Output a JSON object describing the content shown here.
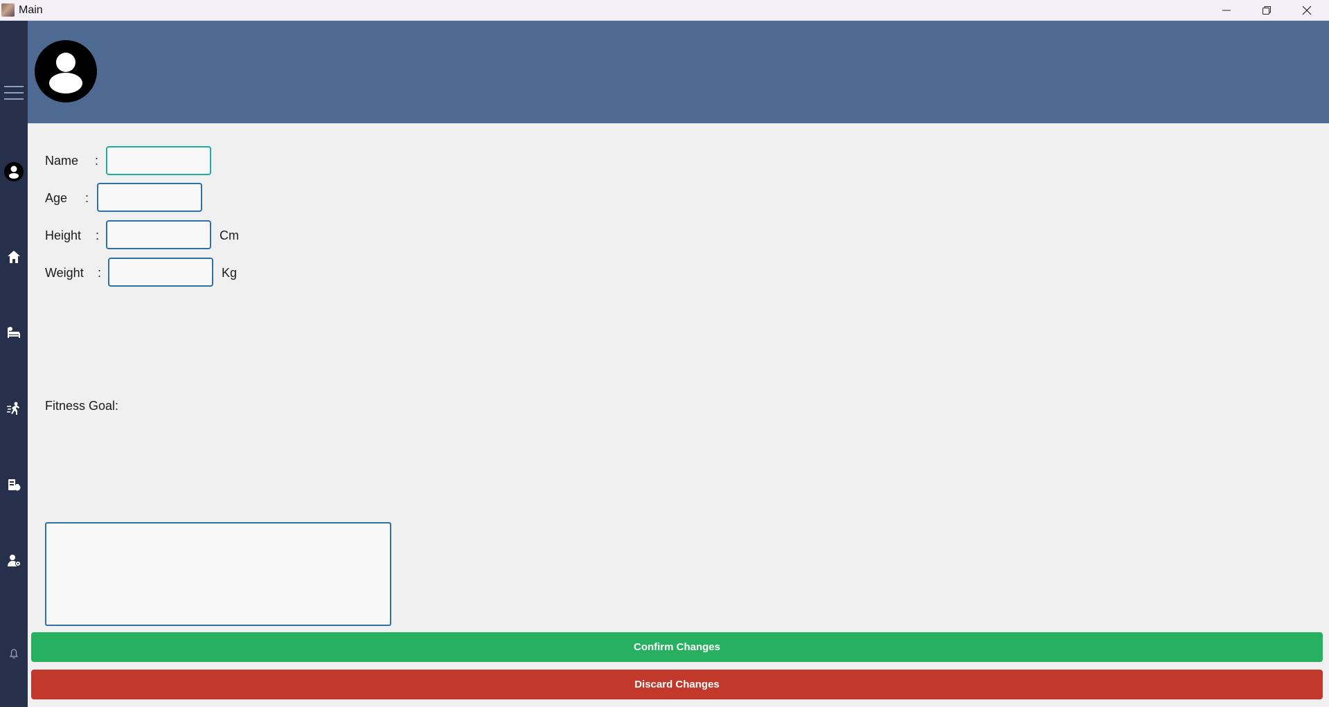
{
  "window": {
    "title": "Main"
  },
  "colors": {
    "sidebar": "#27304a",
    "header": "#4e6a92",
    "confirm": "#27b060",
    "discard": "#c2392b",
    "field_border": "#2f6fa8",
    "field_focus_border": "#1fae9b"
  },
  "sidebar": {
    "items": [
      {
        "icon": "hamburger-menu-icon"
      },
      {
        "icon": "profile-icon"
      },
      {
        "icon": "home-icon"
      },
      {
        "icon": "bed-icon"
      },
      {
        "icon": "running-icon"
      },
      {
        "icon": "nutrition-icon"
      },
      {
        "icon": "user-settings-icon"
      },
      {
        "icon": "bell-icon"
      }
    ]
  },
  "form": {
    "name": {
      "label": "Name",
      "colon": ":",
      "value": ""
    },
    "age": {
      "label": "Age",
      "colon": ":",
      "value": ""
    },
    "height": {
      "label": "Height",
      "colon": ":",
      "value": "",
      "unit": "Cm"
    },
    "weight": {
      "label": "Weight",
      "colon": ":",
      "value": "",
      "unit": "Kg"
    },
    "fitness_goal": {
      "label": "Fitness Goal:",
      "value": ""
    }
  },
  "actions": {
    "confirm_label": "Confirm Changes",
    "discard_label": "Discard Changes"
  }
}
